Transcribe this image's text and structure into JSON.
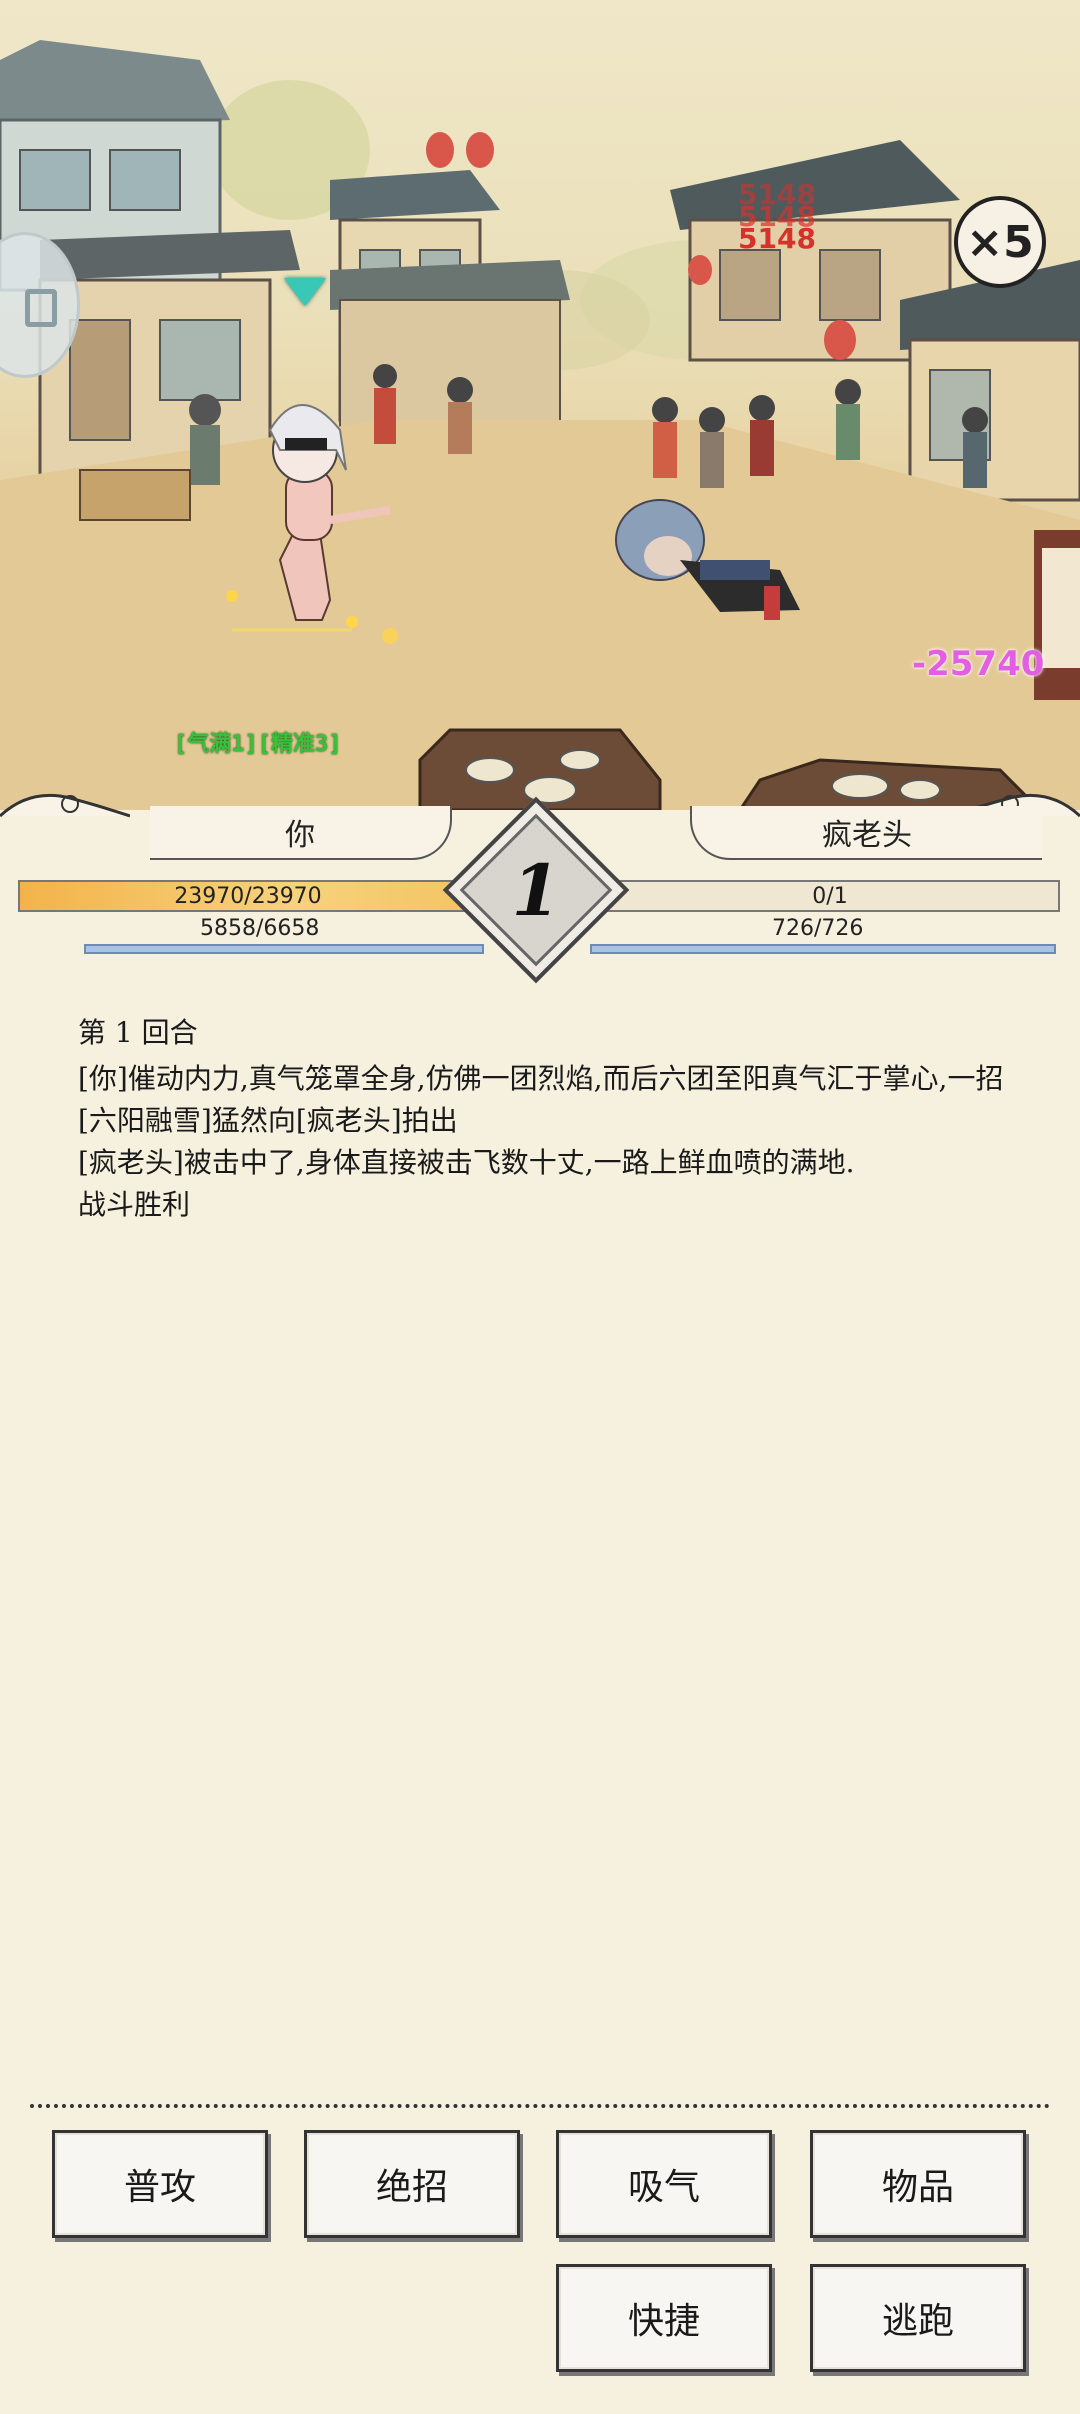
{
  "scene": {
    "speed_multiplier": "×5",
    "damage_on_enemy": "-25740",
    "float_numbers": [
      "5148",
      "5148",
      "5148"
    ],
    "player_status": "[气满1][精准3]",
    "icons": [
      "turn-indicator-icon",
      "speed-badge-icon",
      "side-panel-icon"
    ]
  },
  "battle": {
    "round_number": "1",
    "player": {
      "name": "你",
      "hp_text": "23970/23970",
      "hp_fraction": 1.0,
      "mp_text": "5858/6658",
      "mp_fraction": 0.88
    },
    "enemy": {
      "name": "疯老头",
      "hp_text": "0/1",
      "hp_fraction": 0.0,
      "mp_text": "726/726",
      "mp_fraction": 1.0
    }
  },
  "log": {
    "round_title": "第 1 回合",
    "lines": [
      "[你]催动内力,真气笼罩全身,仿佛一团烈焰,而后六团至阳真气汇于掌心,一招[六阳融雪]猛然向[疯老头]拍出",
      "[疯老头]被击中了,身体直接被击飞数十丈,一路上鲜血喷的满地.",
      "战斗胜利"
    ]
  },
  "actions": {
    "attack": "普攻",
    "ultimate": "绝招",
    "absorb": "吸气",
    "items": "物品",
    "quick": "快捷",
    "flee": "逃跑"
  },
  "colors": {
    "background": "#f6f0df",
    "hp_player": "#f3b34a",
    "damage": "#e25ee2",
    "status": "#38c23a",
    "turn_marker": "#39c7b6"
  }
}
